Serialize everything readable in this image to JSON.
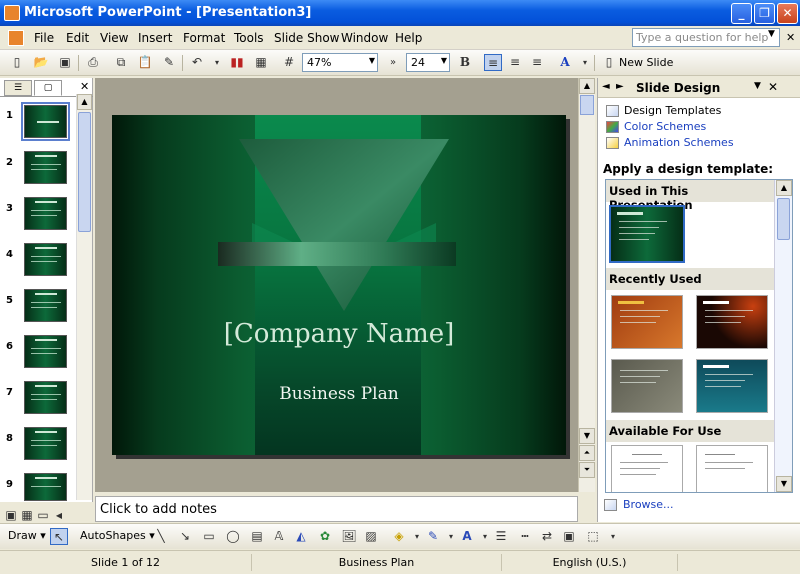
{
  "window": {
    "title": "Microsoft PowerPoint - [Presentation3]"
  },
  "menubar": {
    "items": [
      "File",
      "Edit",
      "View",
      "Insert",
      "Format",
      "Tools",
      "Slide Show",
      "Window",
      "Help"
    ],
    "help_placeholder": "Type a question for help"
  },
  "toolbar": {
    "zoom": "47%",
    "font_size": "24",
    "new_slide_label": "New Slide",
    "bold_label": "B"
  },
  "left_pane": {
    "tabs": [
      "outline-tab",
      "slides-tab"
    ],
    "slide_numbers": [
      "1",
      "2",
      "3",
      "4",
      "5",
      "6",
      "7",
      "8",
      "9"
    ],
    "selected_slide": "1"
  },
  "slide": {
    "company_name": "[Company Name]",
    "subtitle": "Business Plan"
  },
  "notes": {
    "placeholder": "Click to add notes"
  },
  "task_pane": {
    "title": "Slide Design",
    "links": [
      "Design Templates",
      "Color Schemes",
      "Animation Schemes"
    ],
    "apply_label": "Apply a design template:",
    "sections": [
      "Used in This Presentation",
      "Recently Used",
      "Available For Use"
    ],
    "browse_label": "Browse..."
  },
  "drawing_toolbar": {
    "draw_label": "Draw",
    "autoshapes_label": "AutoShapes"
  },
  "status_bar": {
    "slide_info": "Slide 1 of 12",
    "design": "Business Plan",
    "language": "English (U.S.)"
  },
  "colors": {
    "title_bar": "#0a5ce0",
    "slide_green": "#0e7a44",
    "link_blue": "#1a3fbf"
  }
}
